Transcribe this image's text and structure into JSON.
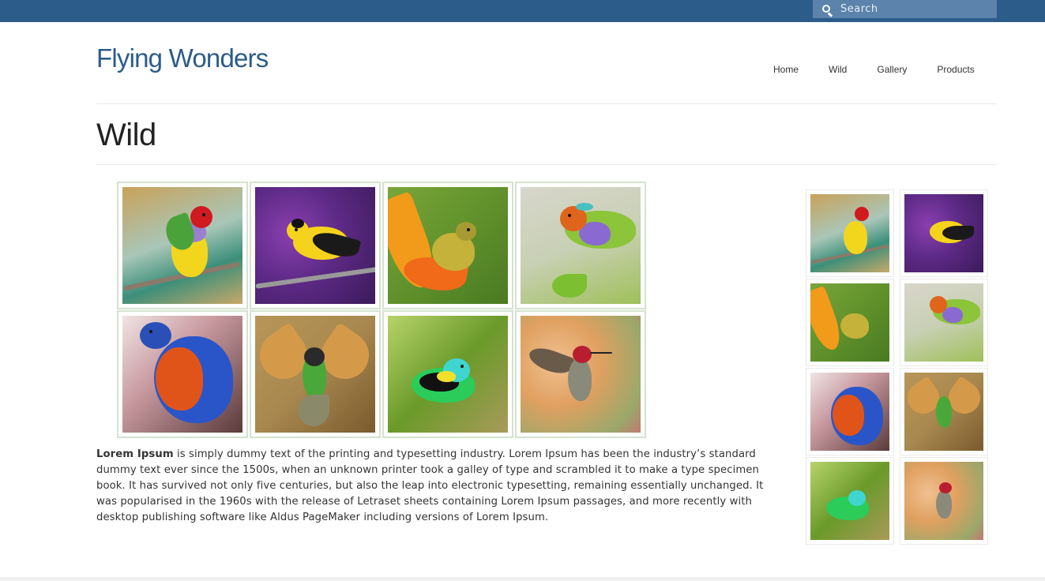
{
  "search": {
    "placeholder": "Search"
  },
  "site": {
    "title": "Flying Wonders"
  },
  "nav": [
    "Home",
    "Wild",
    "Gallery",
    "Products"
  ],
  "page": {
    "title": "Wild"
  },
  "gallery": [
    {
      "name": "gouldian-finch-1"
    },
    {
      "name": "goldfinch"
    },
    {
      "name": "sunbird"
    },
    {
      "name": "gouldian-finch-2"
    },
    {
      "name": "bluebird"
    },
    {
      "name": "bee-eater"
    },
    {
      "name": "tanager"
    },
    {
      "name": "hummingbird"
    }
  ],
  "content": {
    "lead": "Lorem Ipsum",
    "body": " is simply dummy text of the printing and typesetting industry. Lorem Ipsum has been the industry’s standard dummy text ever since the 1500s, when an unknown printer took a galley of type and scrambled it to make a type specimen book. It has survived not only five centuries, but also the leap into electronic typesetting, remaining essentially unchanged. It was popularised in the 1960s with the release of Letraset sheets containing Lorem Ipsum passages, and more recently with desktop publishing software like Aldus PageMaker including versions of Lorem Ipsum."
  },
  "colors": {
    "topbar": "#2c5c8a",
    "accent": "#2c5c8a"
  }
}
